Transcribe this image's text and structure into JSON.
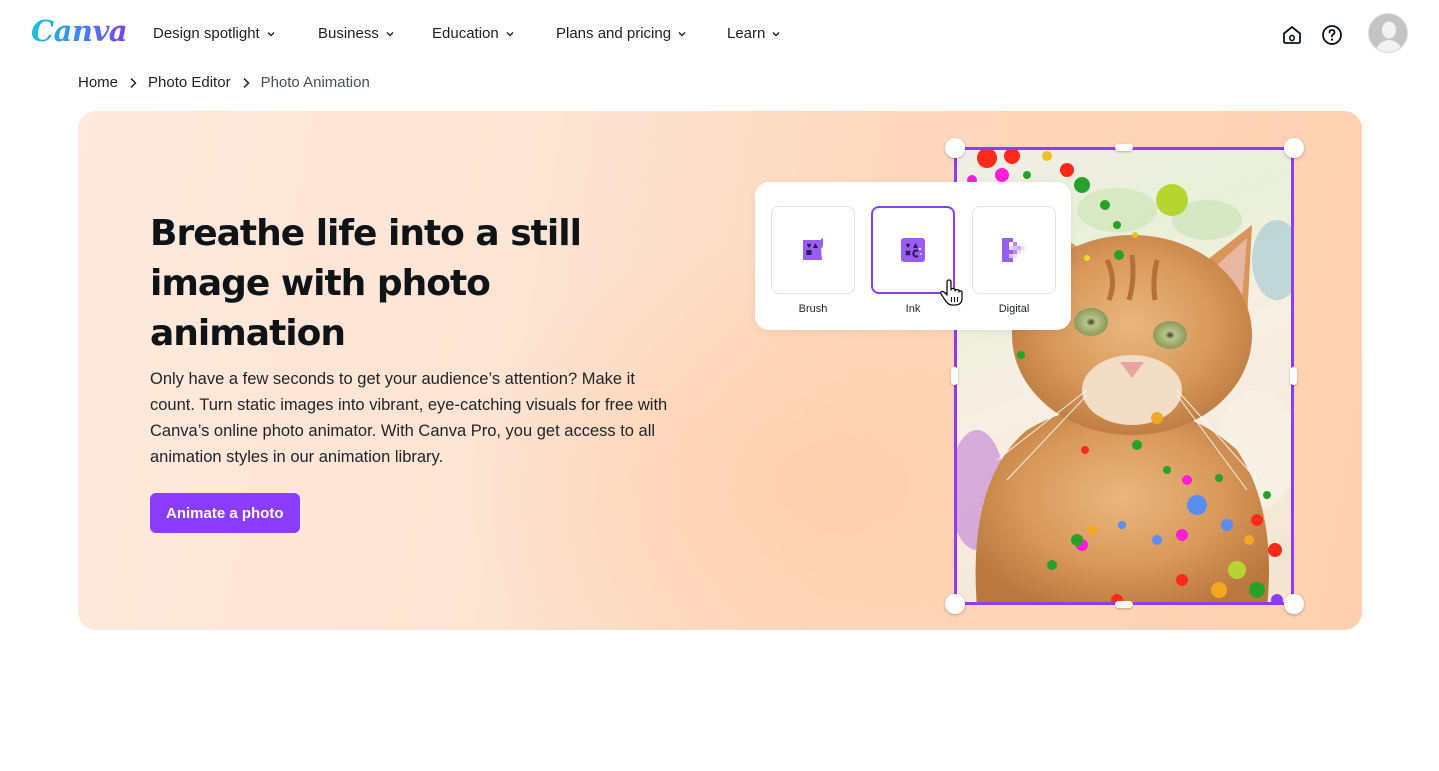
{
  "nav": {
    "logo": "Canva",
    "items": [
      {
        "label": "Design spotlight"
      },
      {
        "label": "Business"
      },
      {
        "label": "Education"
      },
      {
        "label": "Plans and pricing"
      },
      {
        "label": "Learn"
      }
    ],
    "icons": [
      "home-icon",
      "help-icon"
    ],
    "avatar_alt": "User avatar"
  },
  "breadcrumb": [
    {
      "label": "Home"
    },
    {
      "label": "Photo Editor"
    },
    {
      "label": "Photo Animation"
    }
  ],
  "hero": {
    "headline": "Breathe life into a still image with photo animation",
    "description": "Only have a few seconds to get your audience’s attention? Make it count. Turn static images into vibrant, eye-catching visuals for free with Canva’s online photo animator. With Canva Pro, you get access to all animation styles in our animation library.",
    "cta_label": "Animate a photo",
    "accent_color": "#8b3dff",
    "styles": [
      {
        "label": "Brush",
        "icon": "brush-style-icon",
        "selected": false
      },
      {
        "label": "Ink",
        "icon": "ink-style-icon",
        "selected": true
      },
      {
        "label": "Digital",
        "icon": "digital-style-icon",
        "selected": false
      }
    ],
    "image_alt": "Orange tabby cat with colorful paint splatter animation"
  }
}
